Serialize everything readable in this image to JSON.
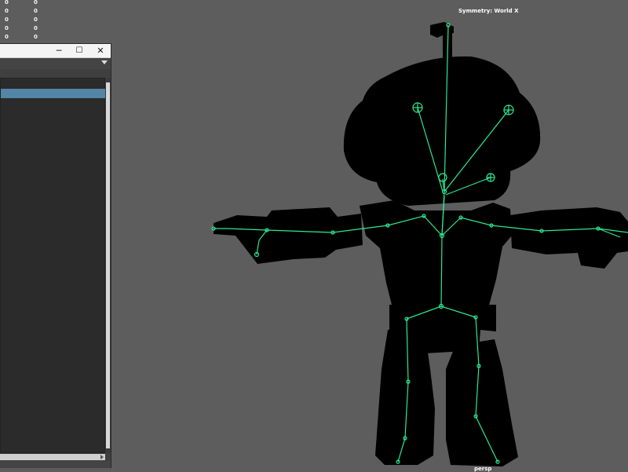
{
  "hud": {
    "stat_values": [
      "0",
      "0",
      "0",
      "0",
      "0",
      "0",
      "0",
      "0",
      "0",
      "0"
    ],
    "symmetry_label": "Symmetry: World X",
    "camera_label": "persp"
  },
  "window": {
    "minimize_glyph": "─",
    "maximize_glyph": "☐",
    "close_glyph": "✕"
  },
  "colors": {
    "viewport_bg": "#5d5d5d",
    "joint_color": "#2ee890",
    "selection_blue": "#5285a6",
    "silhouette": "#000000"
  },
  "icons": [
    "minimize-icon",
    "maximize-icon",
    "close-icon",
    "chevron-down-icon"
  ]
}
